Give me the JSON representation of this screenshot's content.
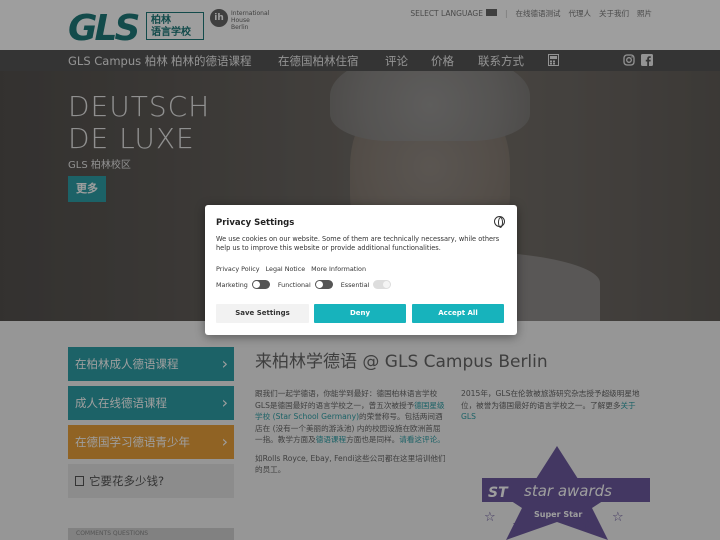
{
  "header": {
    "logo_text": "GLS",
    "logo_cn": "柏林\n语言学校",
    "ih_mark": "ih",
    "ih_text": "International\nHouse\nBerlin",
    "select_language": "SELECT LANGUAGE",
    "links": [
      "在线德语测试",
      "代理人",
      "关于我们",
      "照片"
    ]
  },
  "nav": {
    "items": [
      "GLS Campus 柏林",
      "柏林的德语课程",
      "在德国柏林住宿",
      "评论",
      "价格",
      "联系方式"
    ],
    "icons": [
      "calculator-icon",
      "instagram-icon",
      "facebook-icon"
    ]
  },
  "hero": {
    "title_line1": "DEUTSCH",
    "title_line2": "DE LUXE",
    "subtitle": "GLS 柏林校区",
    "more_button": "更多"
  },
  "sidebar": {
    "items": [
      {
        "label": "在柏林成人德语课程",
        "color": "#2e9fa6"
      },
      {
        "label": "成人在线德语课程",
        "color": "#2e9fa6"
      },
      {
        "label": "在德国学习德语青少年",
        "color": "#e9a13b"
      },
      {
        "label": "它要花多少钱?",
        "color": "#e2e2e2"
      }
    ],
    "bottom_label": "COMMENTS QUESTIONS"
  },
  "main": {
    "title": "来柏林学德语 @ GLS Campus Berlin",
    "col1_p1_a": "跟我们一起学德语，你能学到最好：德国柏林语言学校GLS是德国最好的语言学校之一，曾五次被授予",
    "col1_p1_link": "德国星级学校 (Star School Germany)",
    "col1_p1_b": "的荣誉称号。包括两间酒店在 (没有一个美丽的游泳池) 内的校园设施在欧洲首屈一指。教学方面及",
    "col1_p1_link2": "德语课程",
    "col1_p1_c": "方面也是同样。",
    "col1_p1_link3": "请看这评论。",
    "col1_p2": "如Rolls Royce, Ebay, Fendi这些公司都在这里培训他们的员工。",
    "col2_a": "2015年，GLS在伦敦被旅游研究杂志授予超级明星地位，被誉为德国最好的语言学校之一。了解更多",
    "col2_link": "关于GLS",
    "award_title": "star awards",
    "award_st": "ST",
    "award_sub": "Super Star"
  },
  "modal": {
    "title": "Privacy Settings",
    "text": "We use cookies on our website. Some of them are technically necessary, while others help us to improve this website or provide additional functionalities.",
    "links": [
      "Privacy Policy",
      "Legal Notice",
      "More Information"
    ],
    "toggles": [
      {
        "label": "Marketing",
        "state": "off"
      },
      {
        "label": "Functional",
        "state": "off"
      },
      {
        "label": "Essential",
        "state": "on-disabled"
      }
    ],
    "buttons": {
      "save": "Save Settings",
      "deny": "Deny",
      "accept": "Accept All"
    },
    "accent": "#17b3bc"
  }
}
